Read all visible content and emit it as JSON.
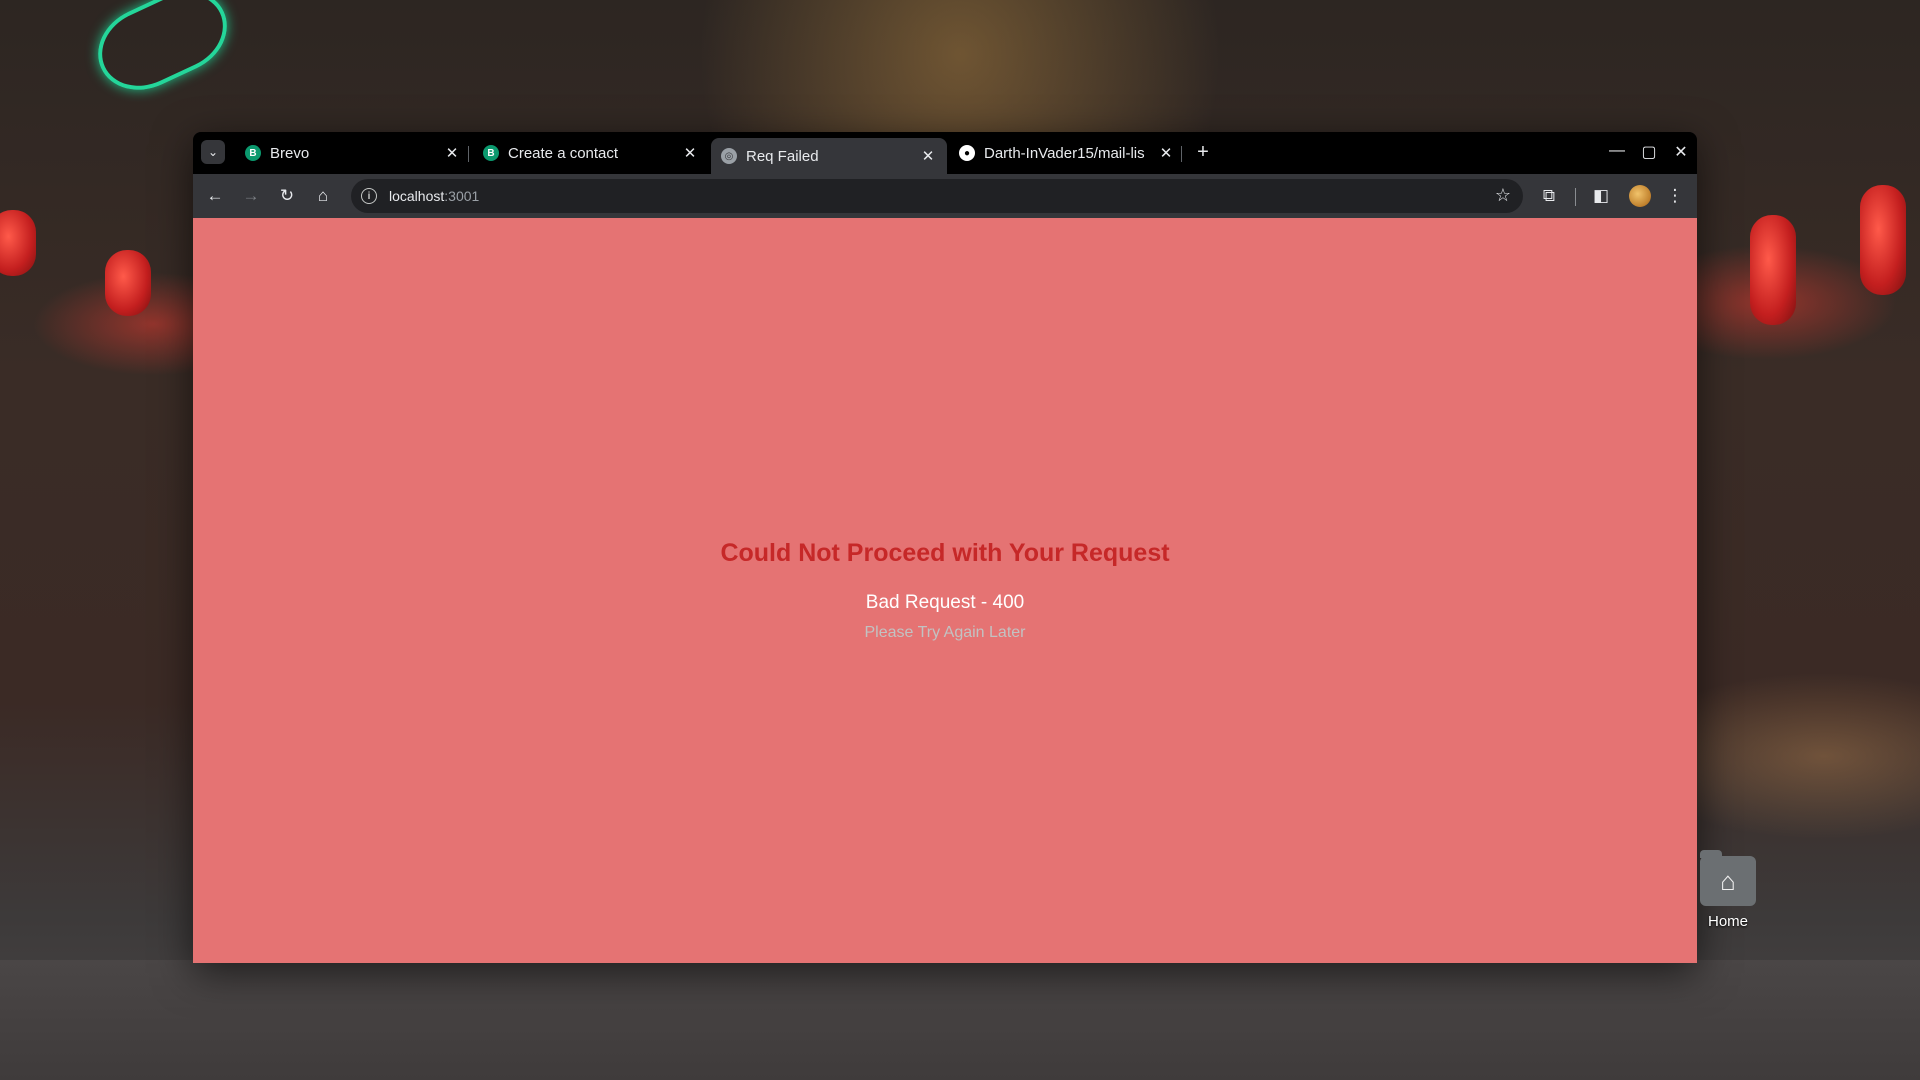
{
  "browser": {
    "tabs": [
      {
        "title": "Brevo",
        "favicon": "brevo-icon",
        "active": false
      },
      {
        "title": "Create a contact",
        "favicon": "brevo-icon",
        "active": false
      },
      {
        "title": "Req Failed",
        "favicon": "globe-icon",
        "active": true
      },
      {
        "title": "Darth-InVader15/mail-lis",
        "favicon": "github-icon",
        "active": false
      }
    ],
    "address": {
      "host": "localhost",
      "port": ":3001"
    }
  },
  "page": {
    "background_color": "#e57373",
    "title": "Could Not Proceed with Your Request",
    "title_color": "#c62828",
    "status": "Bad Request - 400",
    "message": "Please Try Again Later"
  },
  "desktop": {
    "home_label": "Home"
  }
}
